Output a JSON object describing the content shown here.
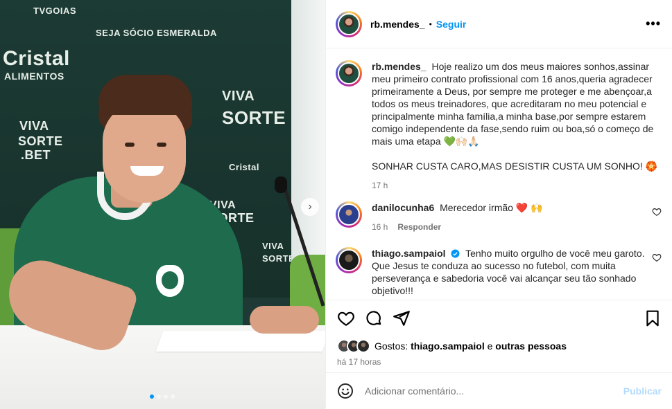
{
  "post": {
    "author": "rb.mendes_",
    "separator": "•",
    "follow_label": "Seguir",
    "more_label": "•••",
    "media": {
      "sponsors": [
        "TVGOIAS",
        "SEJA SÓCIO ESMERALDA",
        "Cristal",
        "ALIMENTOS",
        "VIVA",
        "SORTE",
        "VIVA",
        "SORTE",
        ".BET",
        "VIVA",
        "SORTE",
        "VIVA",
        "SORTE",
        "Cristal"
      ],
      "carousel_total": 4,
      "carousel_active": 1,
      "next_arrow": "›"
    }
  },
  "caption": {
    "username": "rb.mendes_",
    "text": "Hoje realizo um dos meus maiores sonhos,assinar meu primeiro contrato profissional com 16 anos,queria agradecer primeiramente a Deus, por sempre me proteger e me abençoar,a todos os meus treinadores, que acreditaram no meu potencial e principalmente minha família,a minha base,por sempre estarem comigo independente da fase,sendo ruim ou boa,só o começo de mais uma etapa 💚🙌🏻🙏🏻",
    "text2": "SONHAR CUSTA CARO,MAS DESISTIR CUSTA UM SONHO! 🏵️",
    "time": "17 h"
  },
  "comments": [
    {
      "username": "danilocunha6",
      "text": "Merecedor irmão ❤️ 🙌",
      "time": "16 h",
      "reply_label": "Responder"
    },
    {
      "username": "thiago.sampaiol",
      "verified": true,
      "text": "Tenho muito orgulho de você meu garoto. Que Jesus te conduza ao sucesso no futebol, com muita perseverança e sabedoria você vai alcançar seu tão sonhado objetivo!!!"
    }
  ],
  "likes": {
    "prefix": "Gostos:",
    "liker": "thiago.sampaiol",
    "connector": "e",
    "others": "outras pessoas"
  },
  "posted_ago": "há 17 horas",
  "comment_box": {
    "placeholder": "Adicionar comentário...",
    "publish_label": "Publicar"
  },
  "colors": {
    "accent": "#0095f6",
    "publish_disabled": "#b3dbff",
    "muted": "#737373",
    "heart": "#ed4956"
  },
  "icons": [
    "heart-icon",
    "comment-icon",
    "share-icon",
    "bookmark-icon",
    "emoji-icon",
    "verified-icon",
    "more-icon",
    "next-arrow-icon"
  ]
}
